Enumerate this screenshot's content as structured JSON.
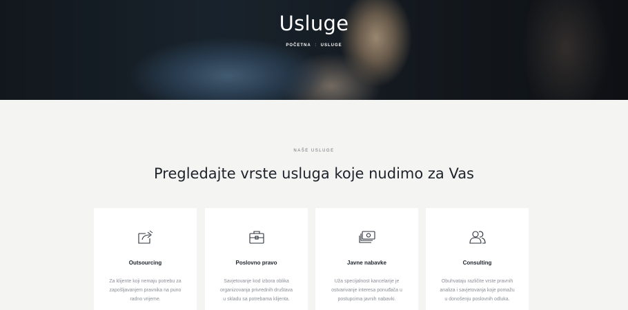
{
  "hero": {
    "title": "Usluge",
    "breadcrumb": {
      "home": "POČETNA",
      "separator": ":",
      "current": "USLUGE"
    }
  },
  "section": {
    "eyebrow": "NAŠE USLUGE",
    "title": "Pregledajte vrste usluga koje nudimo za Vas"
  },
  "cards": [
    {
      "icon": "share-arrow-icon",
      "title": "Outsourcing",
      "desc": [
        "Za klijente koji nemaju potrebu za",
        "zapošljavanjem pravnika na puno",
        "radno vrijeme."
      ]
    },
    {
      "icon": "briefcase-icon",
      "title": "Poslovno pravo",
      "desc": [
        "Savjetovanje kod izbora oblika",
        "organizovanja privrednih društava",
        "u skladu sa potrebama klijenta."
      ]
    },
    {
      "icon": "money-icon",
      "title": "Javne nabavke",
      "desc": [
        "Uža specijalnost kancelarije je",
        "ostvarivanje interesa ponuđača u",
        "postupcima javnih nabavki."
      ]
    },
    {
      "icon": "people-icon",
      "title": "Consulting",
      "desc": [
        "Obuhvataju različite vrste pravnih",
        "analiza i savjetovanja koje pomažu",
        "u donošenju poslovnih odluka."
      ]
    }
  ]
}
